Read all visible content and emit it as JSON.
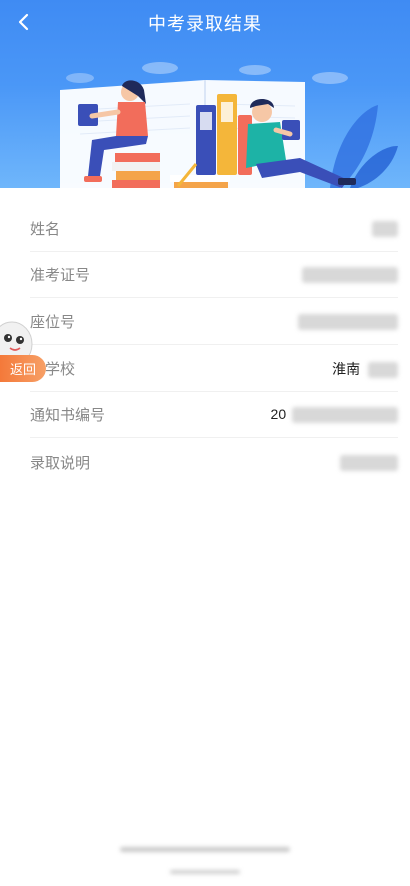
{
  "header": {
    "title": "中考录取结果",
    "back_icon": "chevron-left-icon",
    "gradient_top": "#3f8bf3",
    "gradient_bottom": "#6fb6fb"
  },
  "result": {
    "rows": [
      {
        "label": "姓名",
        "value": ""
      },
      {
        "label": "准考证号",
        "value": ""
      },
      {
        "label": "座位号",
        "value": ""
      },
      {
        "label": "取学校",
        "value": "淮南"
      },
      {
        "label": "通知书编号",
        "value": "20"
      },
      {
        "label": "录取说明",
        "value": ""
      }
    ]
  },
  "floating": {
    "return_label": "返回",
    "accent": "#f4793a"
  }
}
